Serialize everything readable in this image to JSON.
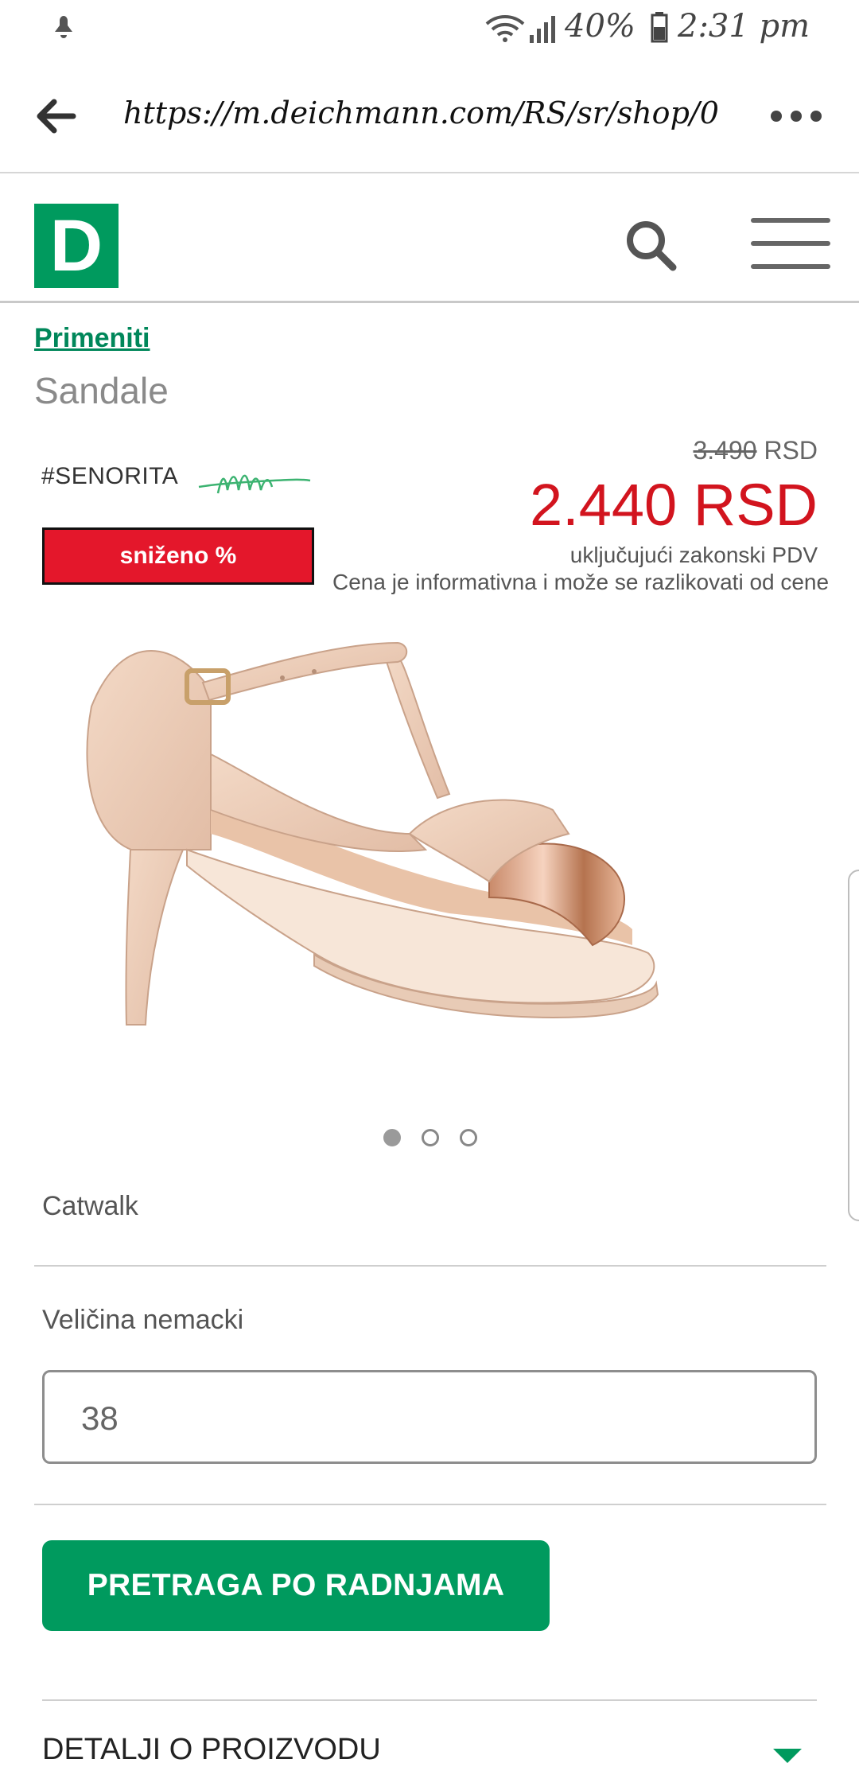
{
  "status_bar": {
    "battery": "40%",
    "time": "2:31 pm",
    "icons": [
      "notification-icon",
      "wifi-icon",
      "signal-icon",
      "battery-icon"
    ]
  },
  "browser": {
    "url": "https://m.deichmann.com/RS/sr/shop/0...",
    "icons": [
      "back-arrow-icon",
      "more-icon"
    ]
  },
  "header": {
    "logo_letter": "D",
    "icons": [
      "search-icon",
      "hamburger-menu-icon"
    ],
    "brand_color": "#009a5e"
  },
  "breadcrumb": {
    "link": "Primeniti",
    "category": "Sandale"
  },
  "product": {
    "tag": "#SENORITA",
    "badge": "sniženo %",
    "old_price": "3.490",
    "old_price_currency": "RSD",
    "new_price": "2.440 RSD",
    "vat_note": "uključujući zakonski PDV",
    "disclaimer": "Cena je informativna i može se razlikovati od cene",
    "image_count": 3,
    "active_image": 1,
    "brand": "Catwalk",
    "price_color": "#d2141e"
  },
  "size": {
    "label": "Veličina nemacki",
    "value": "38"
  },
  "actions": {
    "store_search": "PRETRAGA PO RADNJAMA"
  },
  "details": {
    "label": "DETALJI O PROIZVODU"
  }
}
